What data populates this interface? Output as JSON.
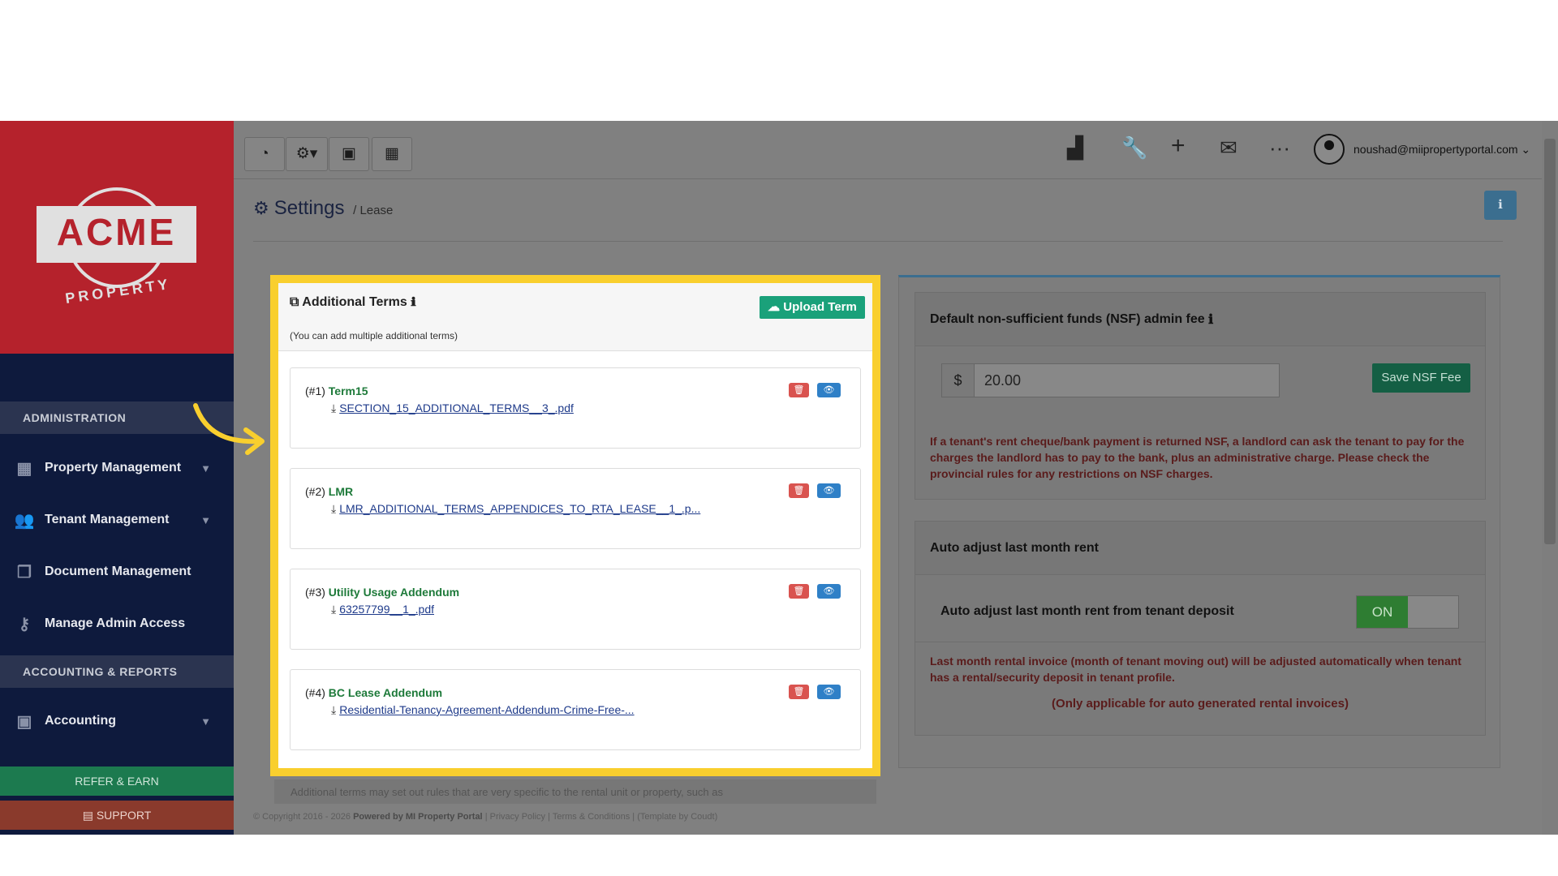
{
  "brand": {
    "logo_text": "ACME",
    "logo_sub": "PROPERTY"
  },
  "sidebar": {
    "sections": [
      {
        "title": "ADMINISTRATION",
        "items": [
          {
            "label": "Property Management",
            "icon": "building-icon",
            "has_chevron": true
          },
          {
            "label": "Tenant Management",
            "icon": "users-icon",
            "has_chevron": true
          },
          {
            "label": "Document Management",
            "icon": "documents-icon",
            "has_chevron": false
          },
          {
            "label": "Manage Admin Access",
            "icon": "key-icon",
            "has_chevron": false
          }
        ]
      },
      {
        "title": "ACCOUNTING & REPORTS",
        "items": [
          {
            "label": "Accounting",
            "icon": "money-icon",
            "has_chevron": true
          }
        ]
      }
    ],
    "refer_label": "REFER & EARN",
    "support_label": "SUPPORT"
  },
  "topbar": {
    "user_email": "noushad@miipropertyportal.com"
  },
  "page": {
    "title": "Settings",
    "breadcrumb": "/ Lease"
  },
  "additional_terms": {
    "title": "Additional Terms",
    "subtitle": "(You can add multiple additional terms)",
    "upload_label": "Upload Term",
    "terms": [
      {
        "num": "(#1)",
        "name": "Term15",
        "file": "SECTION_15_ADDITIONAL_TERMS__3_.pdf"
      },
      {
        "num": "(#2)",
        "name": "LMR",
        "file": "LMR_ADDITIONAL_TERMS_APPENDICES_TO_RTA_LEASE__1_.p..."
      },
      {
        "num": "(#3)",
        "name": "Utility Usage Addendum",
        "file": "63257799__1_.pdf"
      },
      {
        "num": "(#4)",
        "name": "BC Lease Addendum",
        "file": "Residential-Tenancy-Agreement-Addendum-Crime-Free-..."
      }
    ],
    "footer_note": "Additional terms may set out rules that are very specific to the rental unit or property, such as"
  },
  "nsf": {
    "title": "Default non-sufficient funds (NSF) admin fee",
    "currency": "$",
    "value": "20.00",
    "save_label": "Save NSF Fee",
    "description": "If a tenant's rent cheque/bank payment is returned NSF, a landlord can ask the tenant to pay for the charges the landlord has to pay to the bank, plus an administrative charge. Please check the provincial rules for any restrictions on NSF charges."
  },
  "auto_adjust": {
    "title": "Auto adjust last month rent",
    "toggle_label": "Auto adjust last month rent from tenant deposit",
    "toggle_state": "ON",
    "description": "Last month rental invoice (month of tenant moving out) will be adjusted automatically when tenant has a rental/security deposit in tenant profile.",
    "note": "(Only applicable for auto generated rental invoices)"
  },
  "footer": {
    "copyright": "© Copyright 2016 - 2026",
    "powered": "Powered by MI Property Portal",
    "links": "| Privacy Policy | Terms & Conditions |",
    "template": "(Template by Coudt)"
  },
  "colors": {
    "highlight": "#f9cf2e",
    "brand_red": "#b5222c",
    "sidebar": "#0e1a3d",
    "green": "#1aa17a",
    "danger": "#d9534f",
    "info": "#2f80c7"
  }
}
